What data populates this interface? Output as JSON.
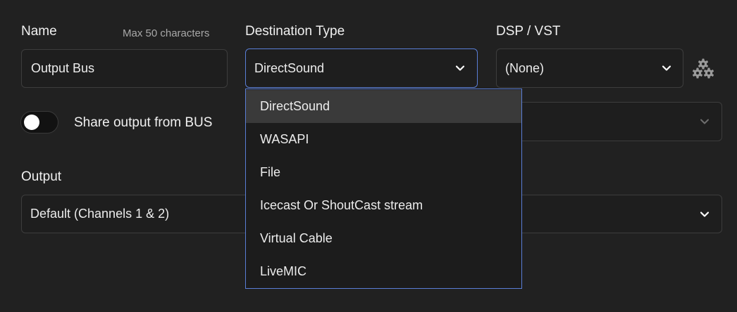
{
  "name_section": {
    "label": "Name",
    "hint": "Max 50 characters",
    "value": "Output Bus"
  },
  "destination_section": {
    "label": "Destination Type",
    "value": "DirectSound",
    "options": [
      "DirectSound",
      "WASAPI",
      "File",
      "Icecast Or ShoutCast stream",
      "Virtual Cable",
      "LiveMIC"
    ],
    "selected_index": 0
  },
  "dsp_section": {
    "label": "DSP / VST",
    "value": "(None)",
    "settings_icon": "gears-icon"
  },
  "share_section": {
    "label": "Share output from BUS",
    "toggle_on": false,
    "bus_value": ""
  },
  "output_section": {
    "label": "Output",
    "value": "Default (Channels 1 & 2)"
  },
  "colors": {
    "background": "#212121",
    "field_background": "#1e1e1e",
    "field_border": "#3d3d3d",
    "focus_border": "#5a7ed6",
    "selected_option": "#3a3a3a"
  },
  "icons": {
    "chevron": "chevron-down-icon",
    "settings": "gears-icon"
  }
}
